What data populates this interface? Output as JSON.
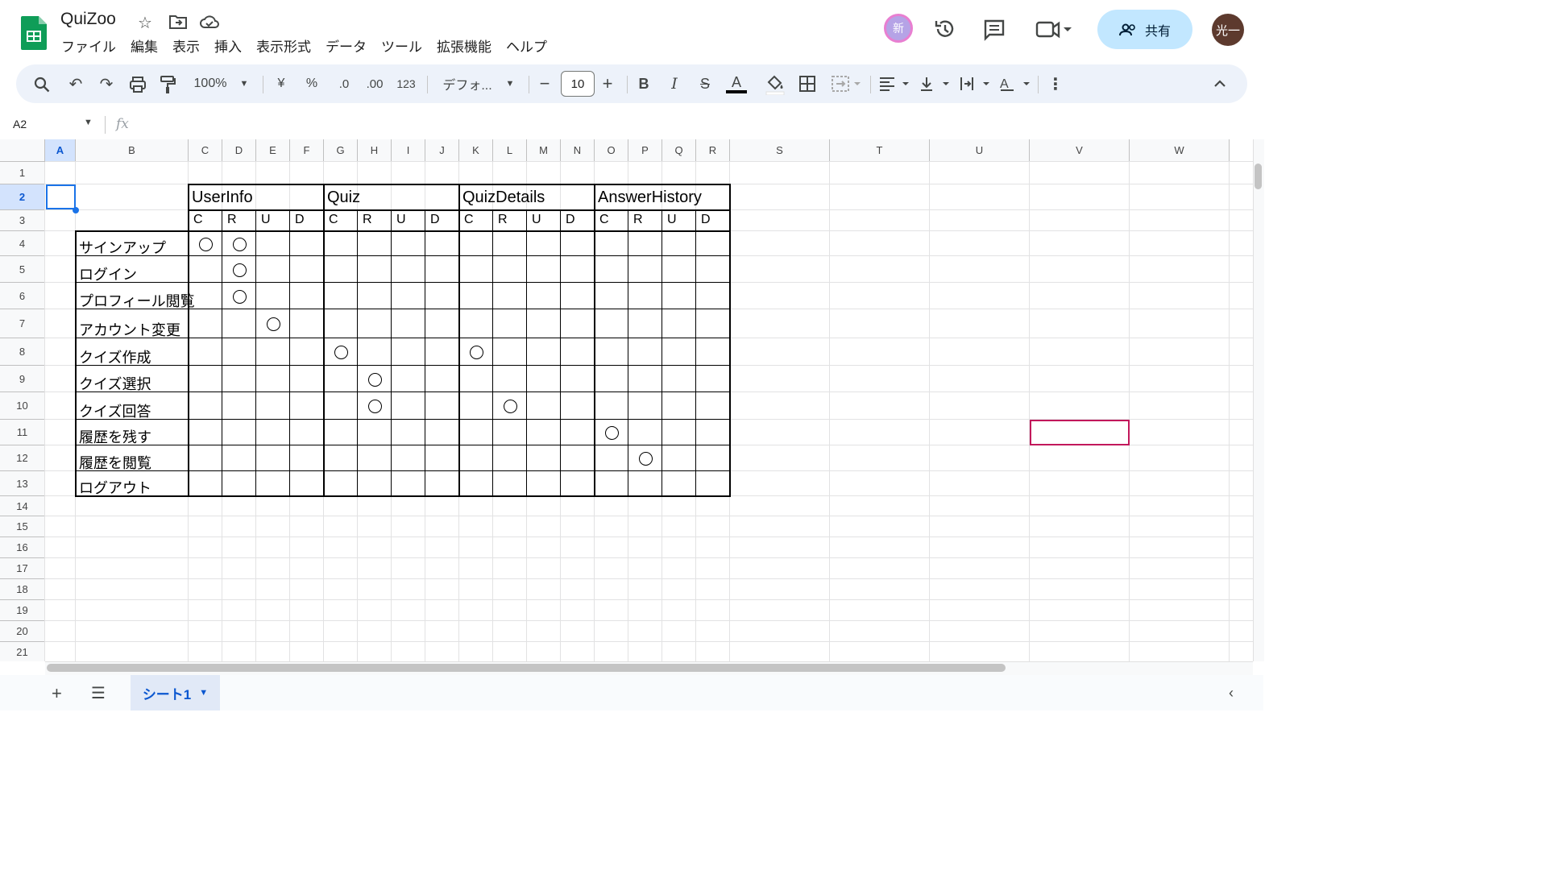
{
  "app": {
    "title": "QuiZoo",
    "menu": [
      "ファイル",
      "編集",
      "表示",
      "挿入",
      "表示形式",
      "データ",
      "ツール",
      "拡張機能",
      "ヘルプ"
    ],
    "share_label": "共有",
    "avatar_new": "新",
    "user_avatar": "光一"
  },
  "toolbar": {
    "zoom": "100%",
    "currency": "¥",
    "percent": "%",
    "dec_decrease": ".0",
    "dec_increase": ".00",
    "number_format": "123",
    "font": "デフォ...",
    "font_size": "10",
    "bold": "B",
    "italic": "I",
    "text_color": "A"
  },
  "formula_bar": {
    "cell_ref": "A2",
    "fx": "fx",
    "value": ""
  },
  "columns": [
    "A",
    "B",
    "C",
    "D",
    "E",
    "F",
    "G",
    "H",
    "I",
    "J",
    "K",
    "L",
    "M",
    "N",
    "O",
    "P",
    "Q",
    "R",
    "S",
    "T",
    "U",
    "V",
    "W"
  ],
  "rows": [
    "1",
    "2",
    "3",
    "4",
    "5",
    "6",
    "7",
    "8",
    "9",
    "10",
    "11",
    "12",
    "13",
    "14",
    "15",
    "16",
    "17",
    "18",
    "19",
    "20",
    "21"
  ],
  "table": {
    "groups": [
      "UserInfo",
      "Quiz",
      "QuizDetails",
      "AnswerHistory"
    ],
    "crud": [
      "C",
      "R",
      "U",
      "D"
    ],
    "row_labels": [
      "サインアップ",
      "ログイン",
      "プロフィール閲覧",
      "アカウント変更",
      "クイズ作成",
      "クイズ選択",
      "クイズ回答",
      "履歴を残す",
      "履歴を閲覧",
      "ログアウト"
    ],
    "marks": [
      [
        0,
        0
      ],
      [
        0,
        1
      ],
      [
        1,
        1
      ],
      [
        2,
        1
      ],
      [
        3,
        2
      ],
      [
        4,
        4
      ],
      [
        4,
        8
      ],
      [
        5,
        5
      ],
      [
        6,
        5
      ],
      [
        6,
        9
      ],
      [
        7,
        12
      ],
      [
        8,
        13
      ]
    ],
    "mark_symbol": "○"
  },
  "sheet_tab": "シート1",
  "colors": {
    "accent": "#1a73e8",
    "share_bg": "#c2e7ff",
    "collab_border": "#c2185b",
    "logo": "#0f9d58"
  }
}
